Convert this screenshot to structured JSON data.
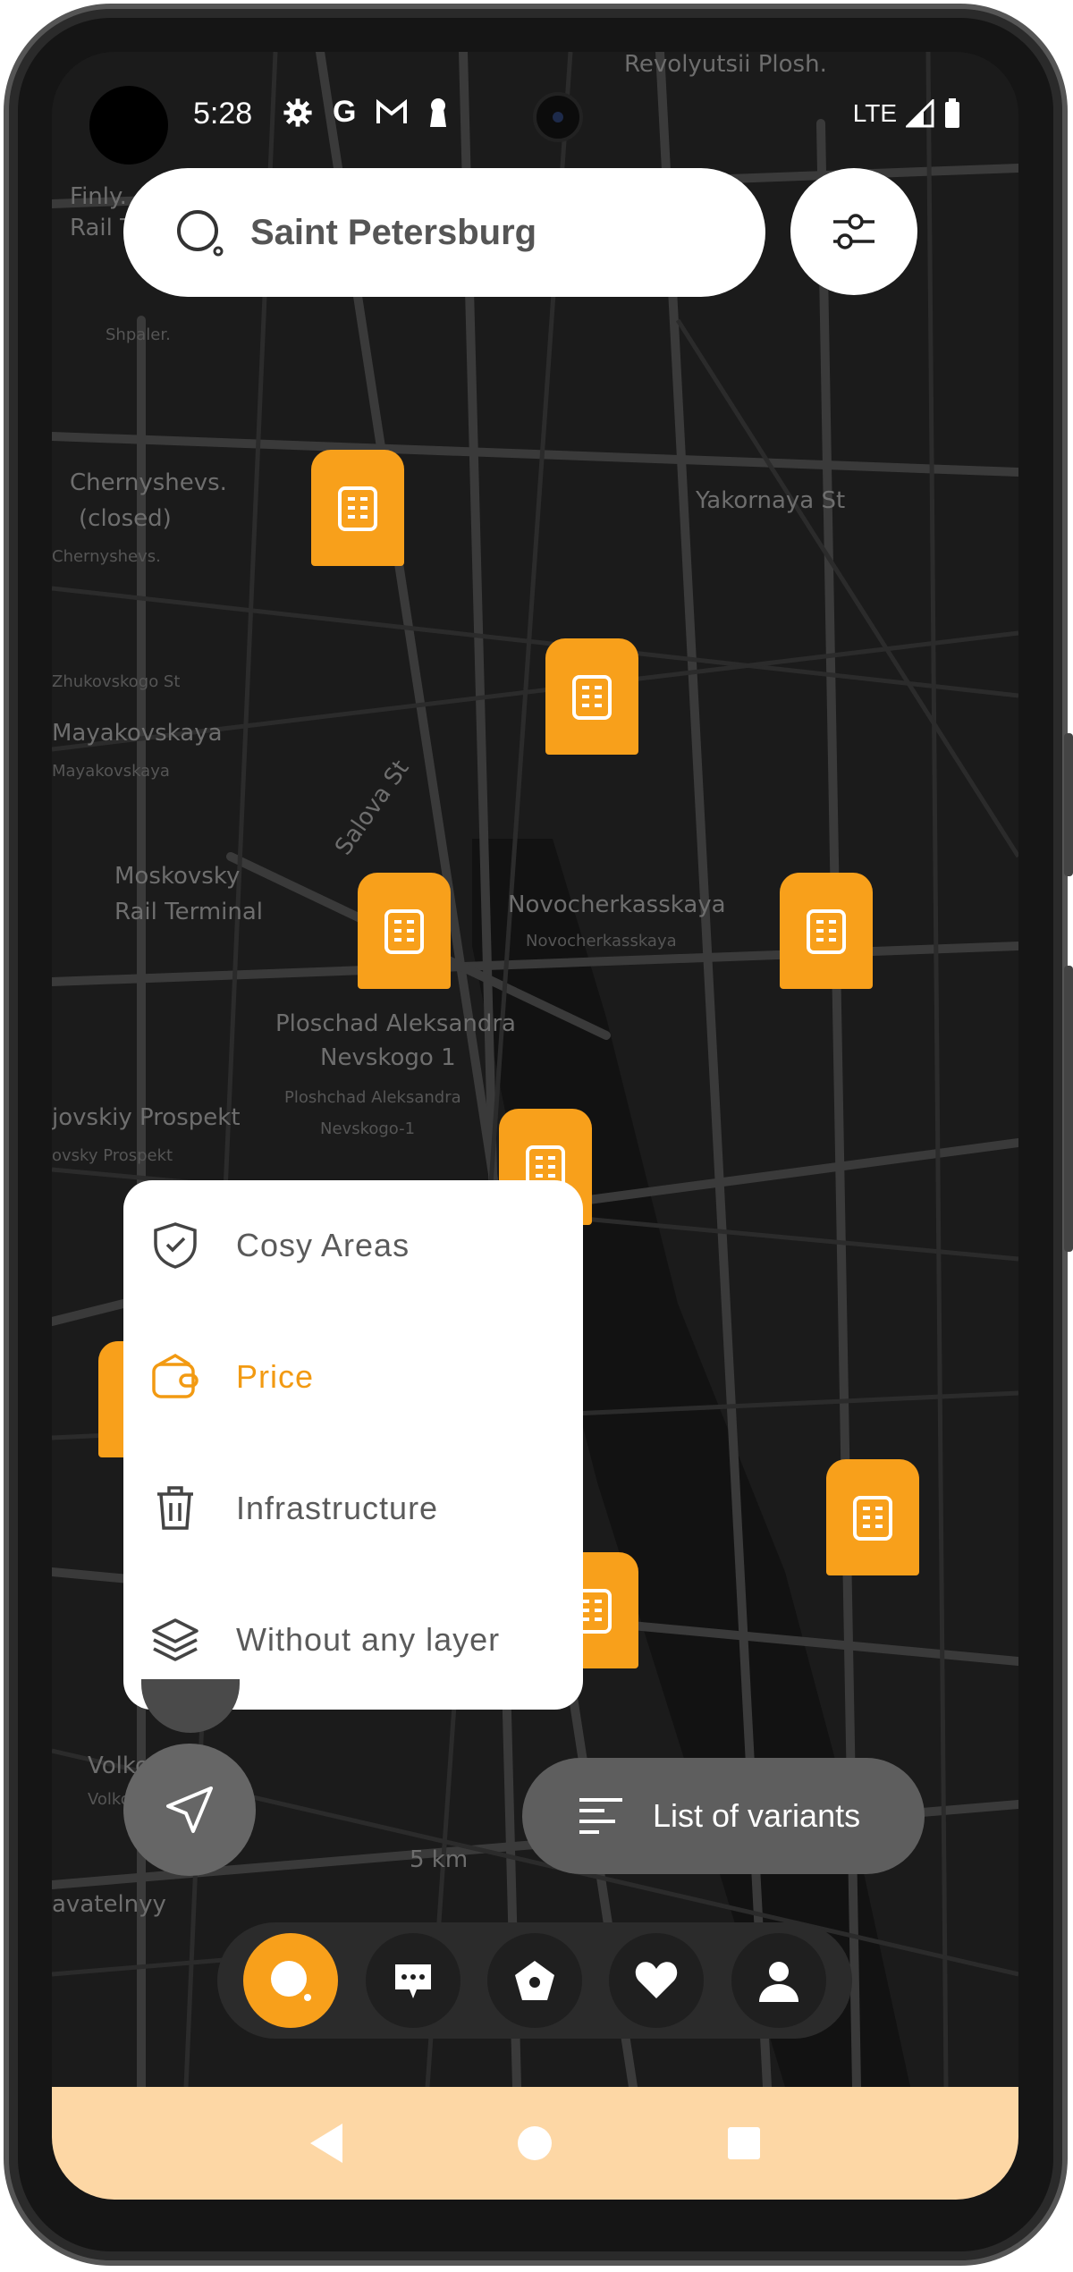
{
  "status_bar": {
    "time": "5:28",
    "network": "LTE",
    "icons": [
      "gear-icon",
      "google-icon",
      "gmail-icon",
      "keyhole-icon",
      "signal-icon",
      "battery-icon"
    ]
  },
  "search": {
    "value": "Saint Petersburg",
    "icon": "search-icon"
  },
  "filter_button": {
    "icon": "sliders-icon"
  },
  "map": {
    "labels": [
      "Revolyutsii Plosh.",
      "Finly.",
      "Rail T.",
      "Shpaler.",
      "Chernyshevs.",
      "(closed)",
      "Chernyshevs.",
      "Zhukovskogo St",
      "Mayakovskaya",
      "Mayakovskaya",
      "Moskovsky",
      "Rail Terminal",
      "Ploschad Aleksandra",
      "Nevskogo 1",
      "Ploshchad Aleksandra",
      "Nevskogo-1",
      "Novocherkasskaya",
      "Novocherkasskaya",
      "jovskiy Prospekt",
      "ovsky Prospekt",
      "Salova St",
      "Yakornaya St",
      "Volkovskaya",
      "Volkovskaya",
      "avatelnyy",
      "5 km"
    ]
  },
  "layer_menu": {
    "items": [
      {
        "label": "Cosy Areas",
        "icon": "shield-check-icon",
        "active": false
      },
      {
        "label": "Price",
        "icon": "wallet-icon",
        "active": true
      },
      {
        "label": "Infrastructure",
        "icon": "trash-icon",
        "active": false
      },
      {
        "label": "Without any layer",
        "icon": "layers-icon",
        "active": false
      }
    ]
  },
  "locate_button": {
    "icon": "navigation-arrow-icon"
  },
  "variants_button": {
    "label": "List of variants",
    "icon": "list-icon"
  },
  "bottom_nav": {
    "items": [
      {
        "icon": "search-icon",
        "active": true
      },
      {
        "icon": "chat-icon",
        "active": false
      },
      {
        "icon": "home-icon",
        "active": false
      },
      {
        "icon": "heart-icon",
        "active": false
      },
      {
        "icon": "profile-icon",
        "active": false
      }
    ]
  },
  "system_nav": {
    "icons": [
      "back-icon",
      "home-icon",
      "recents-icon"
    ]
  },
  "colors": {
    "accent": "#f8a01b",
    "menu_active_text": "#f29a12",
    "nav_bar": "#fdd7a5",
    "map_background": "#1b1b1b"
  }
}
